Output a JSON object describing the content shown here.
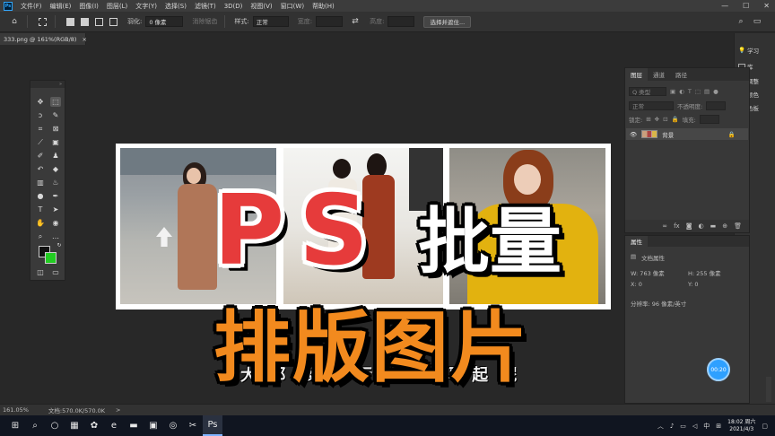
{
  "menubar": {
    "app_icon": "Ps",
    "items": [
      "文件(F)",
      "编辑(E)",
      "图像(I)",
      "图层(L)",
      "文字(Y)",
      "选择(S)",
      "滤镜(T)",
      "3D(D)",
      "视图(V)",
      "窗口(W)",
      "帮助(H)"
    ],
    "window_controls": [
      "—",
      "☐",
      "✕"
    ]
  },
  "options_bar": {
    "feather_label": "羽化:",
    "feather_value": "0 像素",
    "antialias_label": "消除锯齿",
    "style_label": "样式:",
    "style_value": "正常",
    "width_label": "宽度:",
    "height_label": "高度:",
    "select_mask_button": "选择并遮住..."
  },
  "document": {
    "tab_title": "333.png @ 161%(RGB/8)",
    "close": "×"
  },
  "right_strip": {
    "items": [
      "学习",
      "库",
      "调整",
      "颜色",
      "色板"
    ]
  },
  "layers_panel": {
    "tabs": [
      "图层",
      "通道",
      "路径"
    ],
    "search_placeholder": "Q 类型",
    "blend_mode": "正常",
    "opacity_label": "不透明度:",
    "lock_label": "锁定:",
    "fill_label": "填充:",
    "layer_name": "背景"
  },
  "properties_panel": {
    "tab": "属性",
    "heading": "文档属性",
    "w": "W: 763 像素",
    "h": "H: 255 像素",
    "x": "X: 0",
    "y": "Y: 0",
    "resolution": "分辨率: 96 像素/英寸"
  },
  "overlay": {
    "title_ps": "PS",
    "title_batch": "批量",
    "title_layout": "排版图片",
    "subtitle": "大 都 嗲 都 行 个 刻 吗 起 呢"
  },
  "timer_badge": "00:20",
  "statusbar": {
    "zoom": "161.05%",
    "doc_info": "文档:570.0K/570.0K",
    "arrow": ">"
  },
  "taskbar": {
    "time": "18:02 周六",
    "date": "2021/4/3",
    "ime": "中"
  }
}
